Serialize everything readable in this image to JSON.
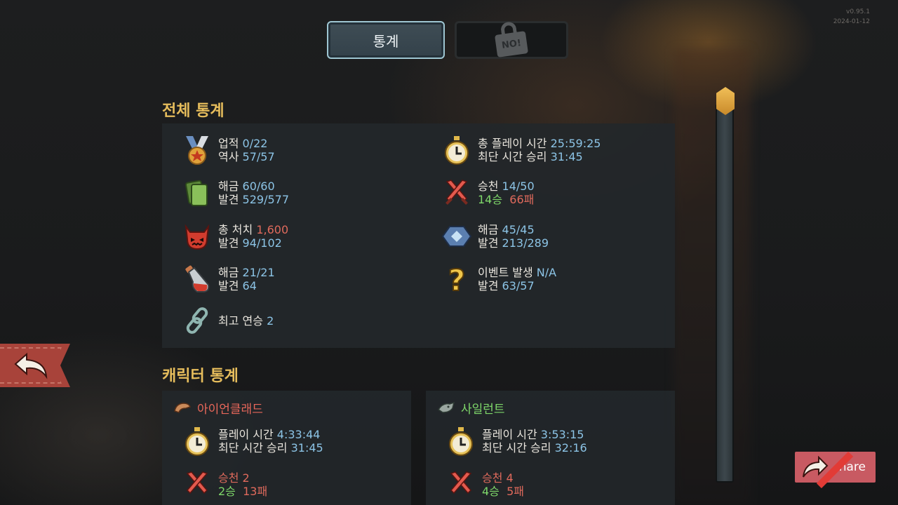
{
  "corner": {
    "line1": "v0.95.1",
    "line2": "2024-01-12"
  },
  "tabs": {
    "stats_label": "통계",
    "locked_label": "NO!"
  },
  "overall": {
    "title": "전체 통계",
    "achievements": {
      "label1": "업적",
      "value1": "0/22",
      "label2": "역사",
      "value2": "57/57"
    },
    "playtime": {
      "label1": "총 플레이 시간",
      "value1": "25:59:25",
      "label2": "최단 시간 승리",
      "value2": "31:45"
    },
    "cards": {
      "label1": "해금",
      "value1": "60/60",
      "label2": "발견",
      "value2": "529/577"
    },
    "ascension": {
      "label1": "승천",
      "value1": "14/50",
      "wins": "14승",
      "losses": "66패"
    },
    "kills": {
      "label1": "총 처치",
      "value1": "1,600",
      "label2": "발견",
      "value2": "94/102"
    },
    "relics": {
      "label1": "해금",
      "value1": "45/45",
      "label2": "발견",
      "value2": "213/289"
    },
    "potions": {
      "label1": "해금",
      "value1": "21/21",
      "label2": "발견",
      "value2": "64"
    },
    "events": {
      "label1": "이벤트 발생",
      "value1": "N/A",
      "label2": "발견",
      "value2": "63/57"
    },
    "streak": {
      "label1": "최고 연승",
      "value1": "2"
    }
  },
  "characters": {
    "title": "캐릭터 통계",
    "list": [
      {
        "name": "아이언클래드",
        "name_color": "#e8675a",
        "playtime_label": "플레이 시간",
        "playtime": "4:33:44",
        "fastest_label": "최단 시간 승리",
        "fastest": "31:45",
        "asc_label": "승천",
        "asc": "2",
        "wins": "2승",
        "losses": "13패"
      },
      {
        "name": "사일런트",
        "name_color": "#7fd86a",
        "playtime_label": "플레이 시간",
        "playtime": "3:53:15",
        "fastest_label": "최단 시간 승리",
        "fastest": "32:16",
        "asc_label": "승천",
        "asc": "4",
        "wins": "4승",
        "losses": "5패"
      }
    ]
  },
  "buttons": {
    "share_label": "hare"
  },
  "colors": {
    "accent_gold": "#e6bd5c",
    "value_blue": "#8cc4e6",
    "value_red": "#e06a5c",
    "value_green": "#7fd86a"
  },
  "icons": [
    "medal-icon",
    "stopwatch-icon",
    "cards-icon",
    "crossed-swords-icon",
    "demon-skull-icon",
    "relic-gem-icon",
    "potion-icon",
    "question-icon",
    "chain-icon",
    "back-arrow-icon",
    "share-arrow-icon"
  ]
}
